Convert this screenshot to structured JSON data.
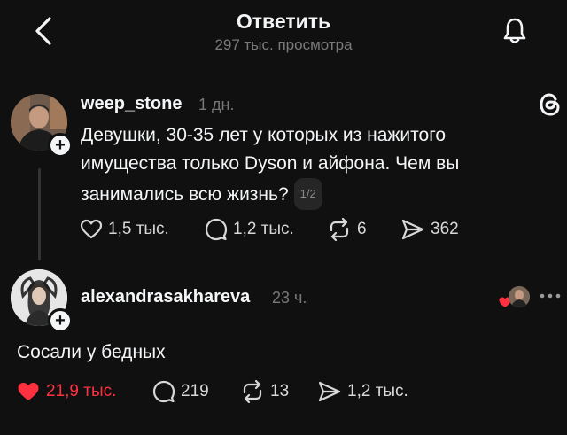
{
  "header": {
    "title": "Ответить",
    "subtitle": "297 тыс. просмотра"
  },
  "post": {
    "username": "weep_stone",
    "time": "1 дн.",
    "text_lines": [
      "Девушки,  30-35 лет у которых из нажитого",
      "имущества только Dyson и  айфона. Чем вы",
      "занимались всю жизнь?"
    ],
    "pager": "1/2",
    "likes": "1,5 тыс.",
    "comments": "1,2 тыс.",
    "reposts": "6",
    "shares": "362"
  },
  "reply": {
    "username": "alexandrasakhareva",
    "time": "23 ч.",
    "text": "Сосали у бедных",
    "likes": "21,9 тыс.",
    "comments": "219",
    "reposts": "13",
    "shares": "1,2 тыс."
  },
  "icons": {
    "back": "chevron-left-icon",
    "bell": "bell-icon",
    "threads": "threads-logo-icon",
    "heart": "heart-icon",
    "comment": "comment-icon",
    "repost": "repost-icon",
    "share": "share-icon",
    "more": "more-icon"
  },
  "colors": {
    "background": "#101010",
    "text": "#f3f5f7",
    "muted": "#777777",
    "liked": "#ff3040"
  }
}
